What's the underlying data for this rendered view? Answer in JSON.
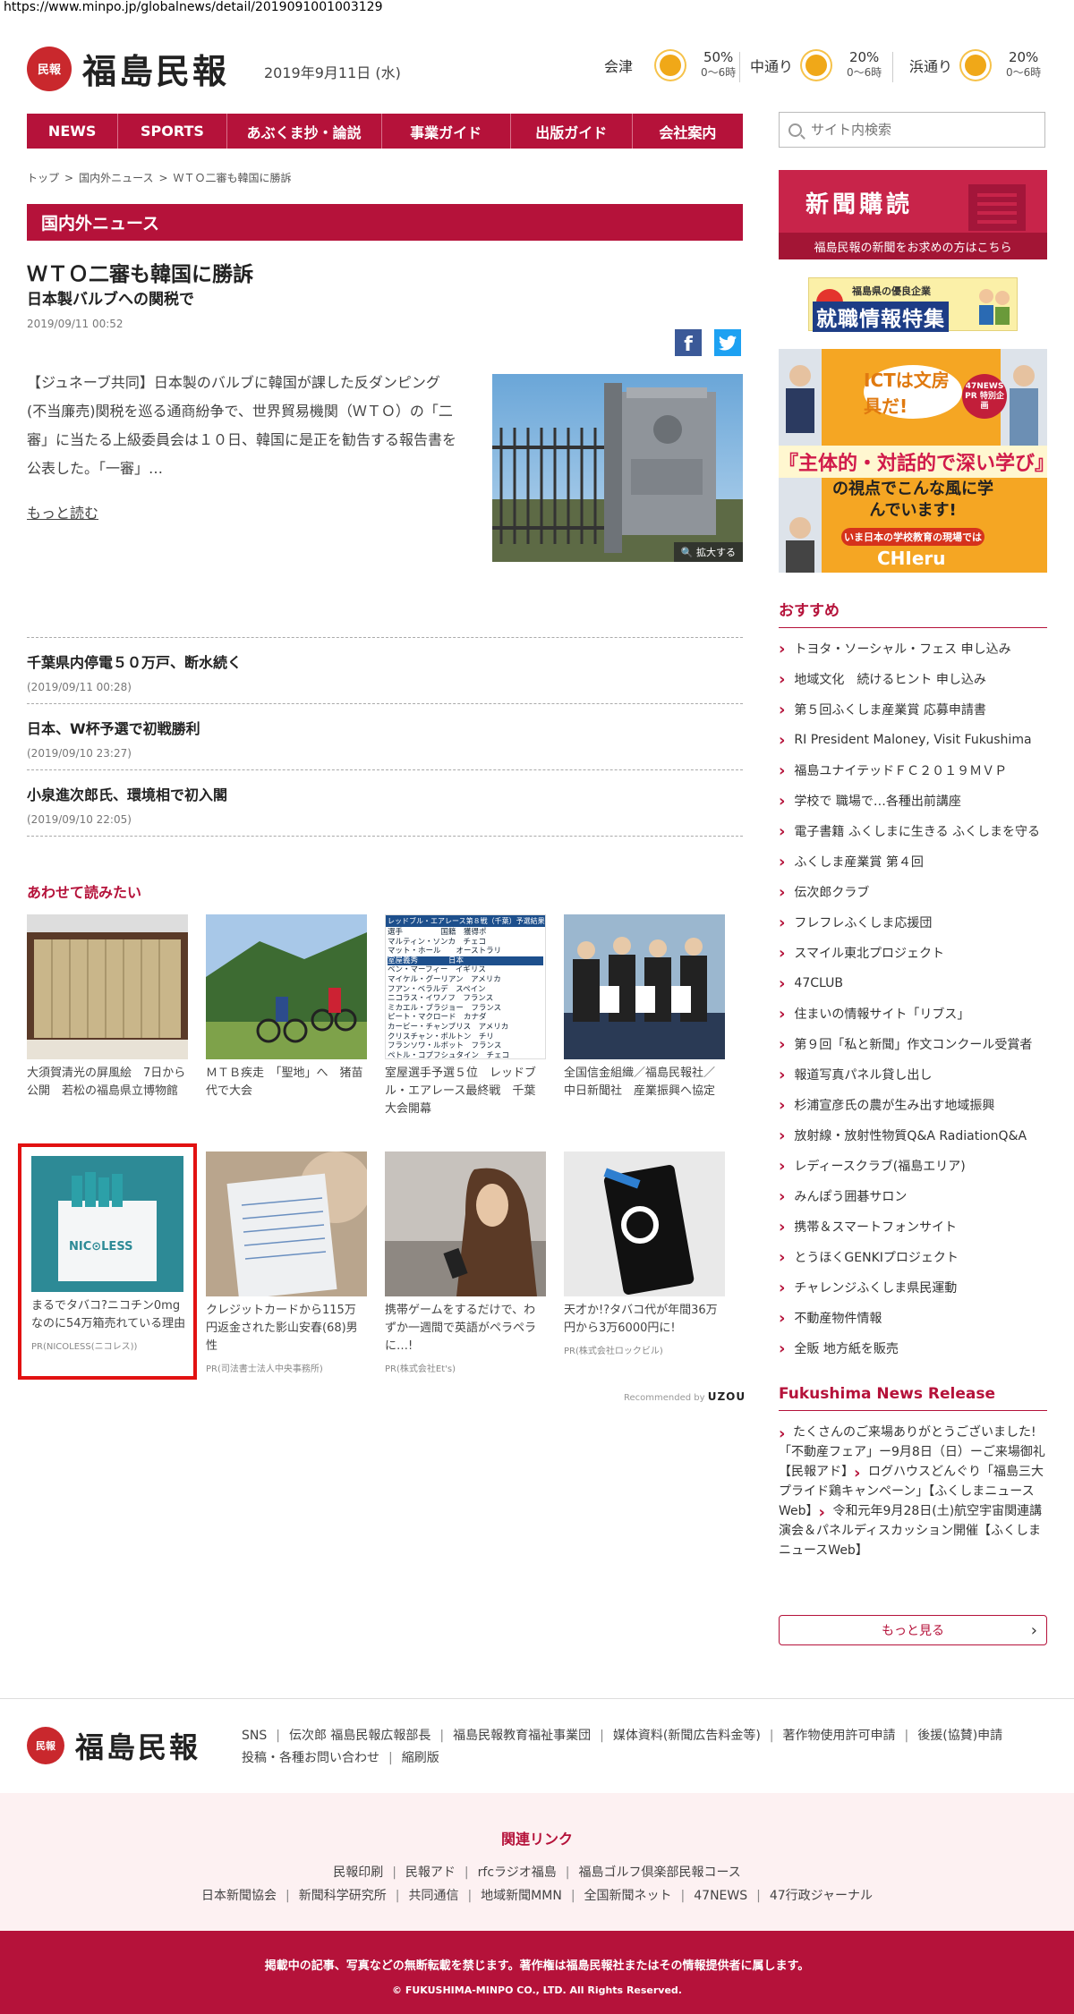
{
  "browser": {
    "url": "https://www.minpo.jp/globalnews/detail/2019091001003129"
  },
  "header": {
    "logo_mark": "民報",
    "logo_text": "福島民報",
    "date": "2019年9月11日 (水)",
    "weather": [
      {
        "loc": "会津",
        "pct": "50%",
        "time": "0〜6時"
      },
      {
        "loc": "中通り",
        "pct": "20%",
        "time": "0〜6時"
      },
      {
        "loc": "浜通り",
        "pct": "20%",
        "time": "0〜6時"
      }
    ]
  },
  "nav": [
    "NEWS",
    "SPORTS",
    "あぶくま抄・論説",
    "事業ガイド",
    "出版ガイド",
    "会社案内"
  ],
  "search": {
    "placeholder": "サイト内検索"
  },
  "breadcrumb": [
    "トップ",
    "国内外ニュース",
    "ＷＴＯ二審も韓国に勝訴"
  ],
  "section_title": "国内外ニュース",
  "article": {
    "title": "ＷＴＯ二審も韓国に勝訴",
    "subtitle": "日本製バルブへの関税で",
    "date": "2019/09/11 00:52",
    "body": "【ジュネーブ共同】日本製のバルブに韓国が課した反ダンピング(不当廉売)関税を巡る通商紛争で、世界貿易機関（ＷＴＯ）の「二審」に当たる上級委員会は１０日、韓国に是正を勧告する報告書を公表した。「一審」…",
    "more": "もっと読む",
    "zoom": "拡大する",
    "fb": "f",
    "tw": "🐦"
  },
  "news": [
    {
      "title": "千葉県内停電５０万戸、断水続く",
      "date": "(2019/09/11 00:28)"
    },
    {
      "title": "日本、W杯予選で初戦勝利",
      "date": "(2019/09/10 23:27)"
    },
    {
      "title": "小泉進次郎氏、環境相で初入閣",
      "date": "(2019/09/10 22:05)"
    }
  ],
  "related": {
    "heading": "あわせて読みたい",
    "cards": [
      {
        "cap": "大須賀清光の屏風絵　7日から公開　若松の福島県立博物館",
        "pr": ""
      },
      {
        "cap": "ＭＴＢ疾走　「聖地」へ　猪苗代で大会",
        "pr": ""
      },
      {
        "cap": "室屋選手予選５位　レッドブル・エアレース最終戦　千葉大会開幕",
        "pr": ""
      },
      {
        "cap": "全国信金組織／福島民報社／中日新聞社　産業振興へ協定",
        "pr": ""
      },
      {
        "cap": "まるでタバコ?ニコチン0mgなのに54万箱売れている理由",
        "pr": "PR(NICOLESS(ニコレス))"
      },
      {
        "cap": "クレジットカードから115万円返金された影山安春(68)男性",
        "pr": "PR(司法書士法人中央事務所)"
      },
      {
        "cap": "携帯ゲームをするだけで、わずか一週間で英語がペラペラに…!",
        "pr": "PR(株式会社Et's)"
      },
      {
        "cap": "天才か!?タバコ代が年間36万円から3万6000円に!",
        "pr": "PR(株式会社ロックビル)"
      }
    ],
    "recommend_label": "Recommended by",
    "recommend_brand": "UZOU",
    "table_rows": [
      "選手　　　　　国籍　獲得ポ",
      "マルティン・ソンカ　チェコ",
      "マット・ホール　　オーストラリ",
      "室屋義秀　　　　日本",
      "ベン・マーフィー　イギリス",
      "マイケル・グーリアン　アメリカ",
      "フアン・ベラルデ　スペイン",
      "ニコラス・イワノフ　フランス",
      "ミカエル・ブラジョー　フランス",
      "ピート・マクロード　カナダ",
      "カービー・チャンブリス　アメリカ",
      "クリスチャン・ボルトン　チリ",
      "フランソワ・ルボット　フランス",
      "ペトル・コプフシュタイン　チェコ"
    ],
    "table_head": "レッドブル・エアレース第８戦（千葉）予選結果"
  },
  "sidebar": {
    "sub_title": "新聞購読",
    "sub_text": "福島民報の新聞をお求めの方はこちら",
    "job_small": "福島県の優良企業",
    "job_big": "就職情報特集",
    "ict_line1": "ICTは文房具だ!",
    "ict_badge": "47NEWS PR 特別企画",
    "ict_line2": "『主体的・対話的で深い学び』",
    "ict_line3": "の視点でこんな風に学んでいます!",
    "ict_line4": "いま日本の学校教育の現場では",
    "ict_brand": "CHIeru",
    "osusume_head": "おすすめ",
    "osusume": [
      "トヨタ・ソーシャル・フェス 申し込み",
      "地域文化　続けるヒント 申し込み",
      "第５回ふくしま産業賞 応募申請書",
      "RI President Maloney, Visit Fukushima",
      "福島ユナイテッドＦＣ２０１９ＭＶＰ",
      "学校で 職場で…各種出前講座",
      "電子書籍 ふくしまに生きる ふくしまを守る",
      "ふくしま産業賞 第４回",
      "伝次郎クラブ",
      "フレフレふくしま応援団",
      "スマイル東北プロジェクト",
      "47CLUB",
      "住まいの情報サイト「リブス」",
      "第９回「私と新聞」作文コンクール受賞者",
      "報道写真パネル貸し出し",
      "杉浦宣彦氏の農が生み出す地域振興",
      "放射線・放射性物質Q&A RadiationQ&A",
      "レディースクラブ(福島エリア)",
      "みんぽう囲碁サロン",
      "携帯＆スマートフォンサイト",
      "とうほくGENKIプロジェクト",
      "チャレンジふくしま県民運動",
      "不動産物件情報",
      "全販 地方紙を販売"
    ],
    "nr_head": "Fukushima News Release",
    "nr": [
      "たくさんのご来場ありがとうございました!「不動産フェア」ー9月8日（日）ーご来場御礼【民報アド】",
      "ログハウスどんぐり「福島三大プライド鶏キャンペーン」【ふくしまニュースWeb】",
      "令和元年9月28日(土)航空宇宙関連講演会＆パネルディスカッション開催【ふくしまニュースWeb】"
    ],
    "more": "もっと見る"
  },
  "footer": {
    "links_row1": [
      "SNS",
      "伝次郎 福島民報広報部長",
      "福島民報教育福祉事業団",
      "媒体資料(新聞広告料金等)",
      "著作物使用許可申請",
      "後援(協賛)申請"
    ],
    "links_row2": [
      "投稿・各種お問い合わせ",
      "縮刷版"
    ],
    "rel_head": "関連リンク",
    "rel_row1": [
      "民報印刷",
      "民報アド",
      "rfcラジオ福島",
      "福島ゴルフ倶楽部民報コース"
    ],
    "rel_row2": [
      "日本新聞協会",
      "新聞科学研究所",
      "共同通信",
      "地域新聞MMN",
      "全国新聞ネット",
      "47NEWS",
      "47行政ジャーナル"
    ],
    "notice": "掲載中の記事、写真などの無断転載を禁じます。著作権は福島民報社またはその情報提供者に属します。",
    "copyright": "© FUKUSHIMA-MINPO CO., LTD. All Rights Reserved."
  }
}
